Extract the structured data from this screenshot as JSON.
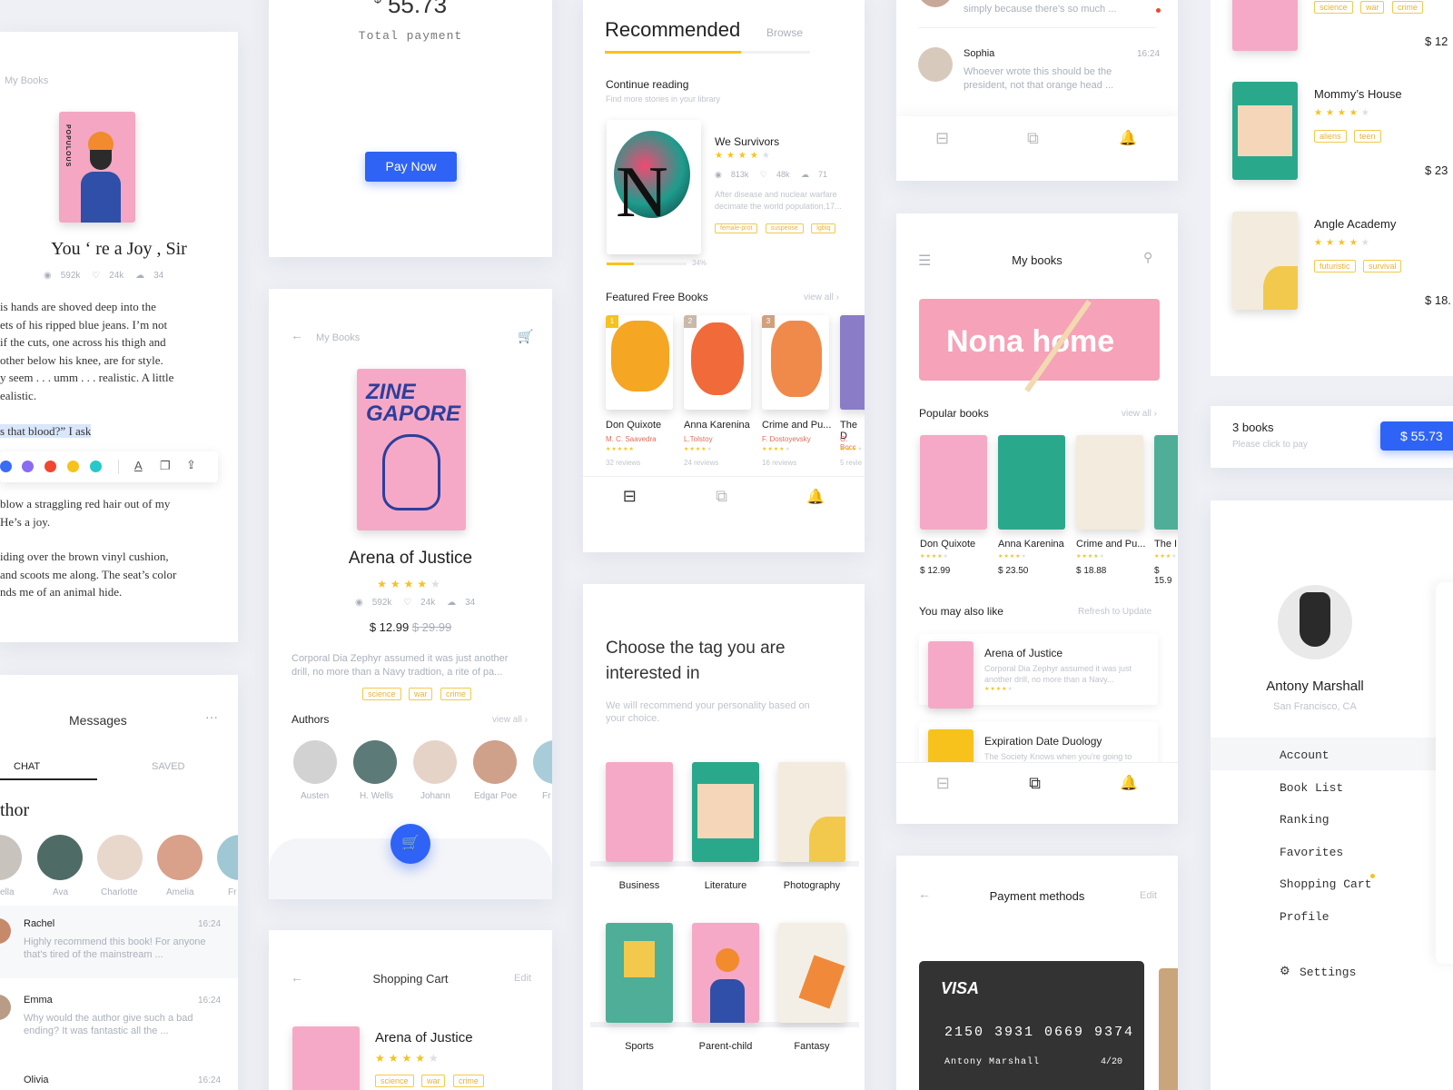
{
  "reader": {
    "breadcrumb": "My Books",
    "title": "You ‘ re a Joy , Sir",
    "stats": {
      "views": "592k",
      "likes": "24k",
      "comments": "34"
    },
    "paragraph1": [
      "is hands are shoved deep into the",
      "ets of his ripped blue jeans. I’m not",
      "if the cuts, one across his thigh and",
      "other below his knee, are for style.",
      "y seem . . . umm . . . realistic. A little",
      "ealistic."
    ],
    "highlight": "s that blood?” I ask",
    "paragraph2": [
      "blow a straggling red hair out of my",
      " He’s a joy."
    ],
    "paragraph3": [
      "iding over the brown vinyl cushion,",
      "and scoots me along. The seat’s color",
      "nds me of an animal hide."
    ],
    "palette": [
      "#3b6cf6",
      "#8b6cf0",
      "#f2462f",
      "#f7c21c",
      "#25c9c9"
    ],
    "cover_word": "POPULOUS"
  },
  "messages": {
    "title": "Messages",
    "tabs": [
      "CHAT",
      "SAVED"
    ],
    "section": "thor",
    "authors": [
      "ella",
      "Ava",
      "Charlotte",
      "Amelia",
      "Fr"
    ],
    "chats": [
      {
        "name": "Rachel",
        "time": "16:24",
        "text1": "Highly recommend this book! For anyone",
        "text2": "that's tired of the mainstream ..."
      },
      {
        "name": "Emma",
        "time": "16:24",
        "text1": "Why would the author give such a bad",
        "text2": "ending? It was fantastic all the ..."
      },
      {
        "name": "Olivia",
        "time": "16:24"
      }
    ]
  },
  "payment": {
    "amount": "55.73",
    "currency": "$",
    "label": "Total payment",
    "button": "Pay Now"
  },
  "detail": {
    "breadcrumb": "My Books",
    "title": "Arena of Justice",
    "stats": {
      "views": "592k",
      "likes": "24k",
      "comments": "34"
    },
    "price": "$ 12.99",
    "old_price": "$ 29.99",
    "desc1": "Corporal Dia Zephyr assumed it was just another",
    "desc2": "drill, no more than a Navy tradtion, a rite of pa...",
    "tags": [
      "science",
      "war",
      "crime"
    ],
    "authors_title": "Authors",
    "view_all": "view all",
    "authors": [
      "Austen",
      "H. Wells",
      "Johann",
      "Edgar Poe",
      "Fr"
    ],
    "rating": 4,
    "cover_title": "ZINE GAPORE"
  },
  "cart_small": {
    "title": "Shopping Cart",
    "edit": "Edit",
    "book": "Arena of Justice",
    "tags": [
      "science",
      "war",
      "crime"
    ]
  },
  "home": {
    "title": "Recommended",
    "browse": "Browse",
    "section1": "Continue reading",
    "section1_sub": "Find more stories in your library",
    "book": "We Survivors",
    "stats": {
      "views": "813k",
      "likes": "48k",
      "comments": "71"
    },
    "desc1": "After disease and nuclear warfare",
    "desc2": "decimate the world population,17...",
    "tags": [
      "female-prot",
      "suspense",
      "lgbtq"
    ],
    "progress": "34%",
    "progress_value": 0.34,
    "section2": "Featured Free Books",
    "view_all": "view all",
    "books": [
      {
        "rank": "1",
        "title": "Don Quixote",
        "author": "M. C. Saavedra",
        "reviews": "32 reviews",
        "color": "#f5a623"
      },
      {
        "rank": "2",
        "title": "Anna Karenina",
        "author": "L.Tolstoy",
        "reviews": "24 reviews",
        "color": "#f06a3a"
      },
      {
        "rank": "3",
        "title": "Crime and Pu...",
        "author": "F. Dostoyevsky",
        "reviews": "16 reviews",
        "color": "#f08a4b"
      },
      {
        "rank": "",
        "title": "The D",
        "author": "G. Bocc",
        "reviews": "5 revie",
        "color": "#8b7cc8"
      }
    ]
  },
  "tags_page": {
    "title1": "Choose the tag you are",
    "title2": "interested in",
    "sub1": "We will recommend your personality based on",
    "sub2": "your choice.",
    "tags": [
      "Business",
      "Literature",
      "Photography",
      "Sports",
      "Parent-child",
      "Fantasy"
    ]
  },
  "chat_top": {
    "text1": "simply because there's so much ...",
    "name": "Sophia",
    "time": "16:24",
    "msg1": "Whoever wrote this should be the",
    "msg2": "president, not that orange head ..."
  },
  "mybooks": {
    "title": "My books",
    "banner": "Nona home",
    "popular": "Popular books",
    "view_all": "view all",
    "books": [
      {
        "title": "Don Quixote",
        "price": "$ 12.99"
      },
      {
        "title": "Anna Karenina",
        "price": "$ 23.50"
      },
      {
        "title": "Crime and Pu...",
        "price": "$ 18.88"
      },
      {
        "title": "The I",
        "price": "$ 15.9"
      }
    ],
    "also_like": "You may also like",
    "refresh": "Refresh to Update",
    "rec": [
      {
        "title": "Arena of Justice",
        "desc1": "Corporal Dia Zephyr assumed it was just",
        "desc2": "another drill, no more than a Navy..."
      },
      {
        "title": "Expiration Date Duology",
        "desc1": "The Society Knows when you're going to"
      }
    ]
  },
  "paymethods": {
    "title": "Payment methods",
    "edit": "Edit",
    "card_brand": "VISA",
    "card_number": "2150 3931 0669 9374",
    "card_name": "Antony Marshall",
    "card_exp": "4/20"
  },
  "cart": {
    "items": [
      {
        "title": "",
        "tags": [
          "science",
          "war",
          "crime"
        ],
        "price": "$ 12"
      },
      {
        "title": "Mommy’s House",
        "tags": [
          "aliens",
          "teen"
        ],
        "price": "$ 23"
      },
      {
        "title": "Angle Academy",
        "tags": [
          "futuristic",
          "survival"
        ],
        "price": "$ 18."
      }
    ],
    "count": "3 books",
    "hint": "Please click to pay",
    "pay": "$ 55.73"
  },
  "profile": {
    "name": "Antony Marshall",
    "location": "San Francisco, CA",
    "menu": [
      "Account",
      "Book List",
      "Ranking",
      "Favorites",
      "Shopping Cart",
      "Profile"
    ],
    "settings": "Settings"
  }
}
